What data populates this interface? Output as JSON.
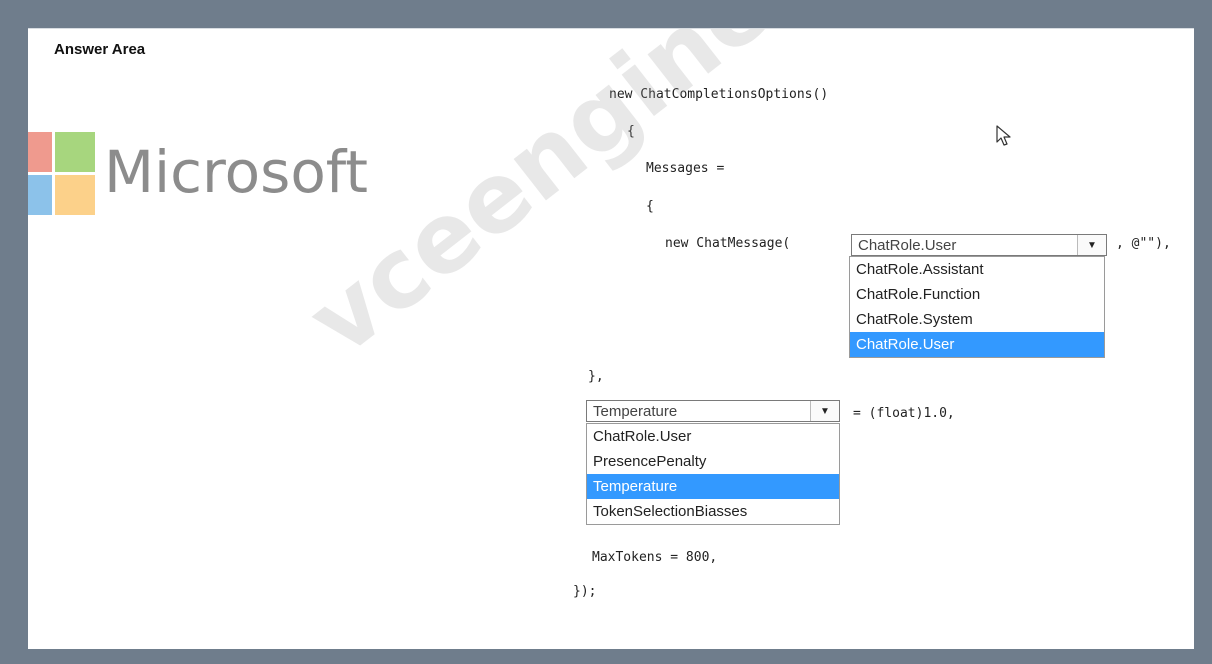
{
  "answer_area": {
    "title": "Answer Area"
  },
  "logo": {
    "text": "Microsoft",
    "colors": [
      "#f25022",
      "#7fba00",
      "#00a4ef",
      "#ffb900"
    ]
  },
  "watermark": {
    "text": "vceengine.com"
  },
  "code": {
    "line1": "new ChatCompletionsOptions()",
    "line2": "{",
    "line3": "Messages =",
    "line4": "{",
    "line5_prefix": "new ChatMessage(",
    "line5_suffix": ", @\"\"),",
    "line6": "},",
    "line7_suffix": "= (float)1.0,",
    "line8": "MaxTokens = 800,",
    "line9": "});"
  },
  "dropdown_role": {
    "selected": "ChatRole.User",
    "options": [
      "ChatRole.Assistant",
      "ChatRole.Function",
      "ChatRole.System",
      "ChatRole.User"
    ],
    "highlighted": "ChatRole.User"
  },
  "dropdown_param": {
    "selected": "Temperature",
    "options": [
      "ChatRole.User",
      "PresencePenalty",
      "Temperature",
      "TokenSelectionBiasses"
    ],
    "highlighted": "Temperature"
  },
  "colors": {
    "selection": "#3399ff",
    "frame": "#6f7d8c"
  }
}
